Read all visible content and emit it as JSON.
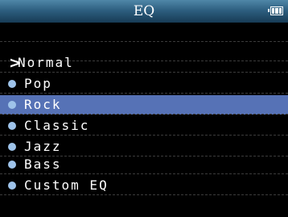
{
  "title": "EQ",
  "battery_icon": "battery-full-icon",
  "current_marker": ">",
  "items": [
    {
      "label": "Normal"
    },
    {
      "label": "Pop"
    },
    {
      "label": "Rock"
    },
    {
      "label": "Classic"
    },
    {
      "label": "Jazz"
    },
    {
      "label": "Bass"
    },
    {
      "label": "Custom EQ"
    }
  ],
  "current_item": "Normal",
  "highlighted_item": "Rock",
  "colors": {
    "title_bar": "#2e5f80",
    "highlight": "#5672b6",
    "bullet": "#9ec3ea",
    "background": "#000000"
  }
}
